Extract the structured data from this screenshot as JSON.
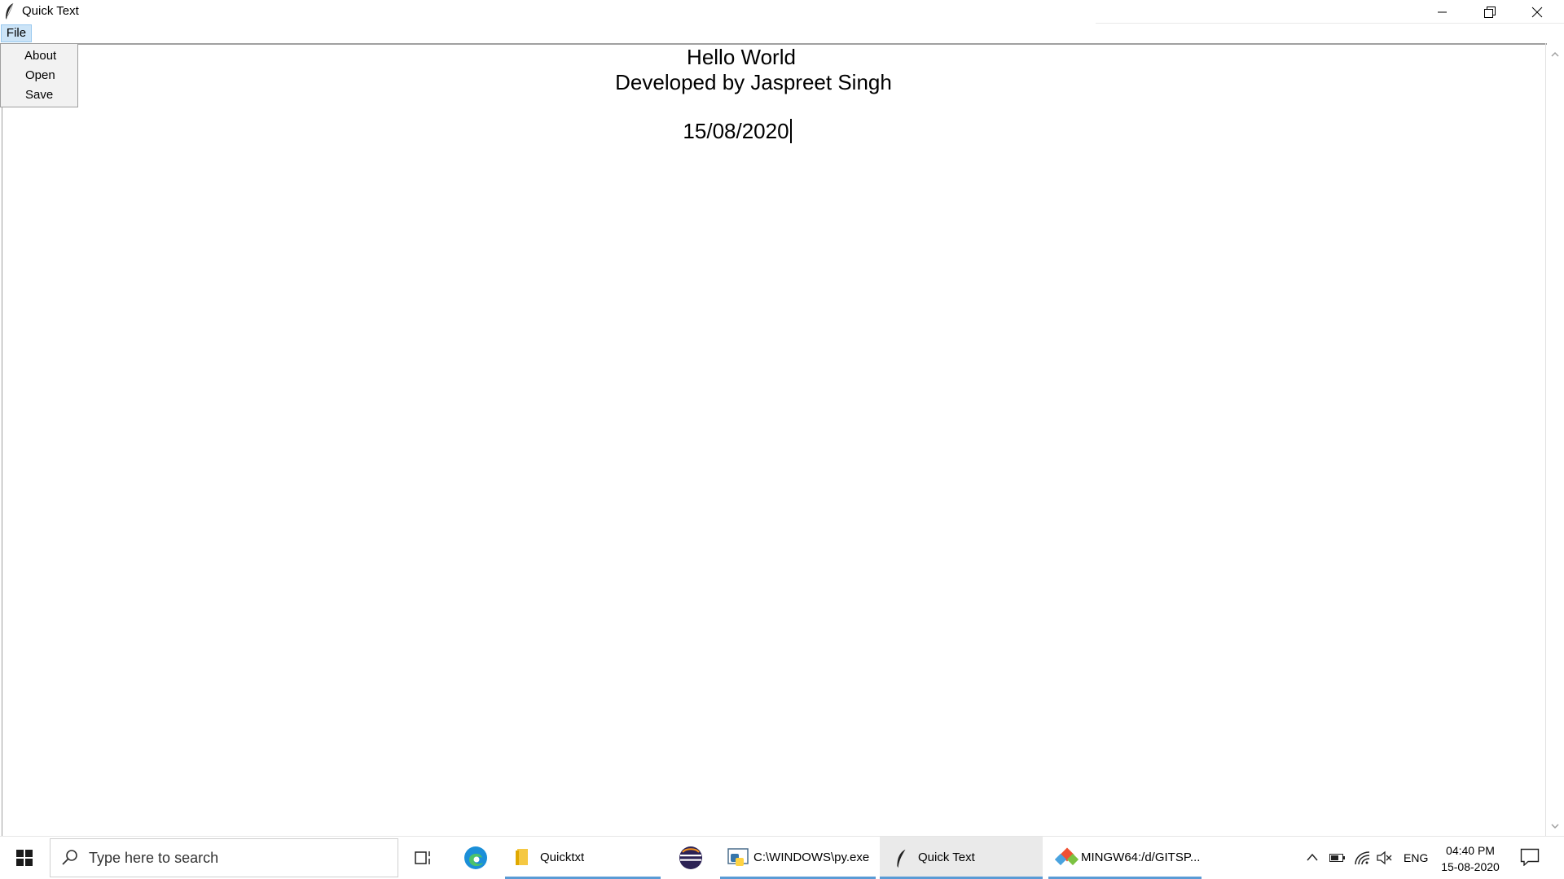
{
  "window": {
    "title": "Quick Text",
    "controls": {
      "minimize": "minimize",
      "restore": "restore",
      "close": "close"
    }
  },
  "menubar": {
    "file_label": "File",
    "file_menu": [
      "About",
      "Open",
      "Save"
    ]
  },
  "document": {
    "line1": "Hello World",
    "line2": "Developed by Jaspreet Singh",
    "line3": "15/08/2020"
  },
  "taskbar": {
    "search_placeholder": "Type here to search",
    "apps": [
      {
        "name": "Quicktxt",
        "icon": "folder-icon"
      },
      {
        "name": "",
        "icon": "eclipse-icon"
      },
      {
        "name": "C:\\WINDOWS\\py.exe",
        "icon": "python-icon"
      },
      {
        "name": "Quick Text",
        "icon": "feather-icon"
      },
      {
        "name": "MINGW64:/d/GITSP...",
        "icon": "git-icon"
      }
    ],
    "tray": {
      "language": "ENG",
      "time": "04:40 PM",
      "date": "15-08-2020"
    }
  },
  "colors": {
    "menu_highlight": "#cce4f7",
    "taskbar_underline": "#5a9bd5",
    "edge_blue": "#1b8fd8"
  }
}
